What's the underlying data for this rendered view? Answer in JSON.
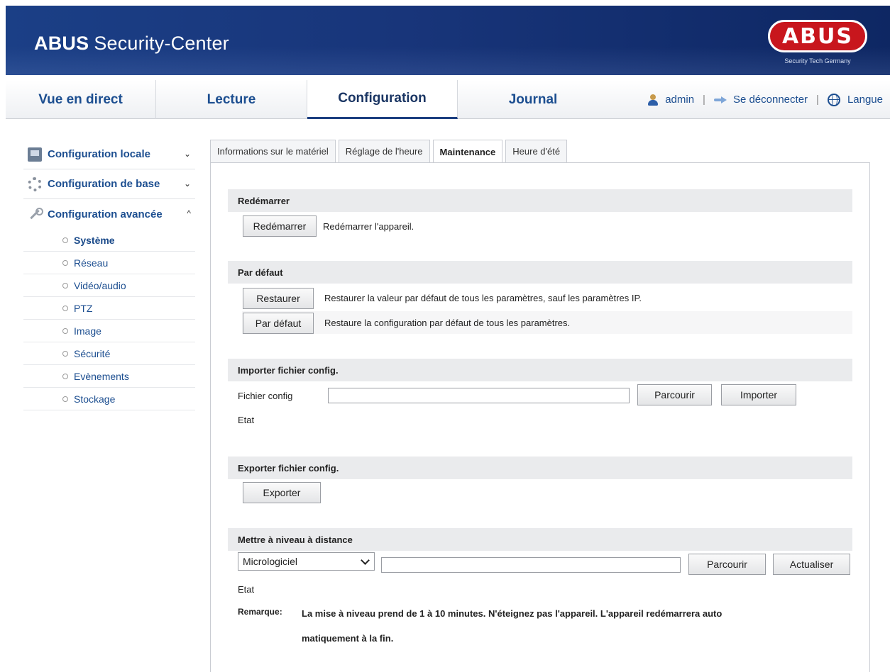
{
  "header": {
    "title_bold": "ABUS",
    "title_rest": "Security-Center",
    "logo_text": "ABUS",
    "logo_tagline": "Security Tech Germany"
  },
  "nav": {
    "tabs": [
      {
        "label": "Vue en direct"
      },
      {
        "label": "Lecture"
      },
      {
        "label": "Configuration"
      },
      {
        "label": "Journal"
      }
    ],
    "active_tab": "Configuration",
    "user": "admin",
    "separator": "|",
    "logout": "Se déconnecter",
    "language": "Langue"
  },
  "sidebar": {
    "groups": [
      {
        "label": "Configuration locale",
        "icon": "local-config-icon",
        "chevron": "⌄"
      },
      {
        "label": "Configuration de base",
        "icon": "base-config-icon",
        "chevron": "⌄"
      },
      {
        "label": "Configuration avancée",
        "icon": "wrench-icon",
        "chevron": "^"
      }
    ],
    "sub_items": [
      {
        "label": "Système"
      },
      {
        "label": "Réseau"
      },
      {
        "label": "Vidéo/audio"
      },
      {
        "label": "PTZ"
      },
      {
        "label": "Image"
      },
      {
        "label": "Sécurité"
      },
      {
        "label": "Evènements"
      },
      {
        "label": "Stockage"
      }
    ],
    "active_sub": "Système"
  },
  "content_tabs": [
    {
      "label": "Informations sur le matériel"
    },
    {
      "label": "Réglage de l'heure"
    },
    {
      "label": "Maintenance"
    },
    {
      "label": "Heure d'été"
    }
  ],
  "active_content_tab": "Maintenance",
  "sections": {
    "reboot": {
      "title": "Redémarrer",
      "button": "Redémarrer",
      "description": "Redémarrer l'appareil."
    },
    "default": {
      "title": "Par défaut",
      "restore_button": "Restaurer",
      "restore_description": "Restaurer la valeur par défaut de tous les paramètres, sauf les paramètres IP.",
      "default_button": "Par défaut",
      "default_description": "Restaure la configuration par défaut de tous les paramètres."
    },
    "import": {
      "title": "Importer fichier config.",
      "file_label": "Fichier config",
      "file_value": "",
      "browse_button": "Parcourir",
      "import_button": "Importer",
      "status_label": "Etat"
    },
    "export": {
      "title": "Exporter fichier config.",
      "export_button": "Exporter"
    },
    "upgrade": {
      "title": "Mettre à niveau à distance",
      "select_value": "Micrologiciel",
      "file_value": "",
      "browse_button": "Parcourir",
      "update_button": "Actualiser",
      "status_label": "Etat",
      "note_label": "Remarque:",
      "note_line1": "La mise à niveau prend de 1 à 10 minutes. N'éteignez pas l'appareil. L'appareil redémarrera auto",
      "note_line2": "matiquement à la fin."
    }
  }
}
